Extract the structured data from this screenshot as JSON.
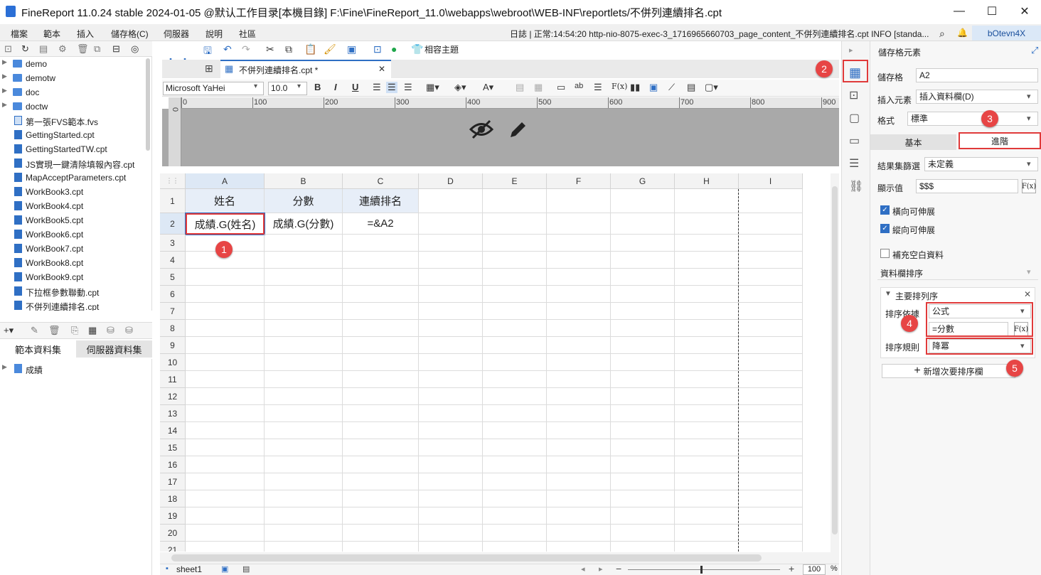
{
  "window": {
    "title": "FineReport 11.0.24 stable 2024-01-05 @默认工作目录[本機目錄]    F:\\Fine\\FineReport_11.0\\webapps\\webroot\\WEB-INF\\reportlets/不併列連續排名.cpt",
    "minimize": "—",
    "maximize": "☐",
    "close": "✕"
  },
  "menu": {
    "items": [
      "檔案",
      "範本",
      "插入",
      "儲存格(C)",
      "伺服器",
      "說明",
      "社區"
    ],
    "log": "日誌 | 正常:14:54:20 http-nio-8075-exec-3_1716965660703_page_content_不併列連續排名.cpt INFO [standa...",
    "user": "bOtevn4X"
  },
  "file_tree": {
    "items": [
      {
        "label": "demo",
        "type": "folder"
      },
      {
        "label": "demotw",
        "type": "folder"
      },
      {
        "label": "doc",
        "type": "folder"
      },
      {
        "label": "doctw",
        "type": "folder"
      },
      {
        "label": "第一張FVS範本.fvs",
        "type": "fvs"
      },
      {
        "label": "GettingStarted.cpt",
        "type": "cpt"
      },
      {
        "label": "GettingStartedTW.cpt",
        "type": "cpt"
      },
      {
        "label": "JS實現一鍵清除填報內容.cpt",
        "type": "cpt"
      },
      {
        "label": "MapAcceptParameters.cpt",
        "type": "cpt"
      },
      {
        "label": "WorkBook3.cpt",
        "type": "cpt"
      },
      {
        "label": "WorkBook4.cpt",
        "type": "cpt"
      },
      {
        "label": "WorkBook5.cpt",
        "type": "cpt"
      },
      {
        "label": "WorkBook6.cpt",
        "type": "cpt"
      },
      {
        "label": "WorkBook7.cpt",
        "type": "cpt"
      },
      {
        "label": "WorkBook8.cpt",
        "type": "cpt"
      },
      {
        "label": "WorkBook9.cpt",
        "type": "cpt"
      },
      {
        "label": "下拉框參數聯動.cpt",
        "type": "cpt"
      },
      {
        "label": "不併列連續排名.cpt",
        "type": "cpt"
      }
    ]
  },
  "datasets": {
    "tabs": [
      "範本資料集",
      "伺服器資料集"
    ],
    "items": [
      "成績"
    ]
  },
  "toolbar": {
    "theme_label": "相容主題"
  },
  "doc_tab": {
    "label": "不併列連續排名.cpt *",
    "close": "✕"
  },
  "format": {
    "font": "Microsoft YaHei",
    "size": "10.0",
    "bold": "B",
    "italic": "I",
    "underline": "U"
  },
  "ruler": {
    "ticks": [
      "0",
      "100",
      "200",
      "300",
      "400",
      "500",
      "600",
      "700",
      "800",
      "900"
    ]
  },
  "grid": {
    "columns": [
      "A",
      "B",
      "C",
      "D",
      "E",
      "F",
      "G",
      "H",
      "I"
    ],
    "rows": [
      "1",
      "2",
      "3",
      "4",
      "5",
      "6",
      "7",
      "8",
      "9",
      "10",
      "11",
      "12",
      "13",
      "14",
      "15",
      "16",
      "17",
      "18",
      "19",
      "20",
      "21"
    ],
    "cells": {
      "A1": "姓名",
      "B1": "分數",
      "C1": "連續排名",
      "A2": "成績.G(姓名)",
      "B2": "成績.G(分數)",
      "C2": "=&A2"
    }
  },
  "sheet": {
    "name": "sheet1",
    "zoom": "100",
    "zoom_unit": "%"
  },
  "panel": {
    "title": "儲存格元素",
    "cell_label": "儲存格",
    "cell_value": "A2",
    "insert_label": "插入元素",
    "insert_value": "插入資料欄(D)",
    "format_label": "格式",
    "format_value": "標準",
    "tabs": [
      "基本",
      "進階"
    ],
    "filter_label": "結果集篩選",
    "filter_value": "未定義",
    "display_label": "顯示值",
    "display_value": "$$$",
    "h_expand": "橫向可伸展",
    "v_expand": "縱向可伸展",
    "fill_blank": "補充空白資料",
    "sort_section": "資料欄排序",
    "primary_sort": "主要排列序",
    "sort_by_label": "排序依據",
    "sort_by_value": "公式",
    "formula_value": "=分數",
    "sort_rule_label": "排序規則",
    "sort_rule_value": "降冪",
    "add_sort": "新增次要排序欄"
  },
  "badges": [
    "1",
    "2",
    "3",
    "4",
    "5"
  ],
  "colors": {
    "accent": "#2f6fc4",
    "highlight_red": "#e03a3a",
    "badge": "#e74545"
  }
}
